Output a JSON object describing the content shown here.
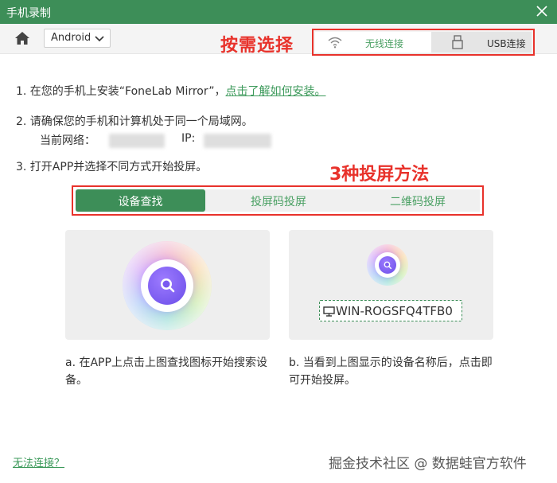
{
  "window": {
    "title": "手机录制"
  },
  "toolbar": {
    "os_selected": "Android"
  },
  "annotations": {
    "choose_label": "按需选择",
    "methods_label": "3种投屏方法"
  },
  "connection": {
    "wifi_label": "无线连接",
    "usb_label": "USB连接"
  },
  "steps": {
    "step1_prefix": "1. 在您的手机上安装“FoneLab Mirror”，",
    "step1_link": "点击了解如何安装。",
    "step2": "2. 请确保您的手机和计算机处于同一个局域网。",
    "network_label": "当前网络：",
    "ip_label": "IP:",
    "step3": "3. 打开APP并选择不同方式开始投屏。"
  },
  "methods": {
    "tab_find": "设备查找",
    "tab_code": "投屏码投屏",
    "tab_qr": "二维码投屏"
  },
  "cards": {
    "device_name": "WIN-ROGSFQ4TFB0",
    "desc_a": "a. 在APP上点击上图查找图标开始搜索设备。",
    "desc_b": "b. 当看到上图显示的设备名称后，点击即可开始投屏。"
  },
  "footer": {
    "help_link": "无法连接？",
    "watermark": "掘金技术社区 @ 数据蛙官方软件"
  },
  "colors": {
    "brand_green": "#3d8e58",
    "annotation_red": "#e8322b",
    "link_green": "#3d9a5b"
  }
}
